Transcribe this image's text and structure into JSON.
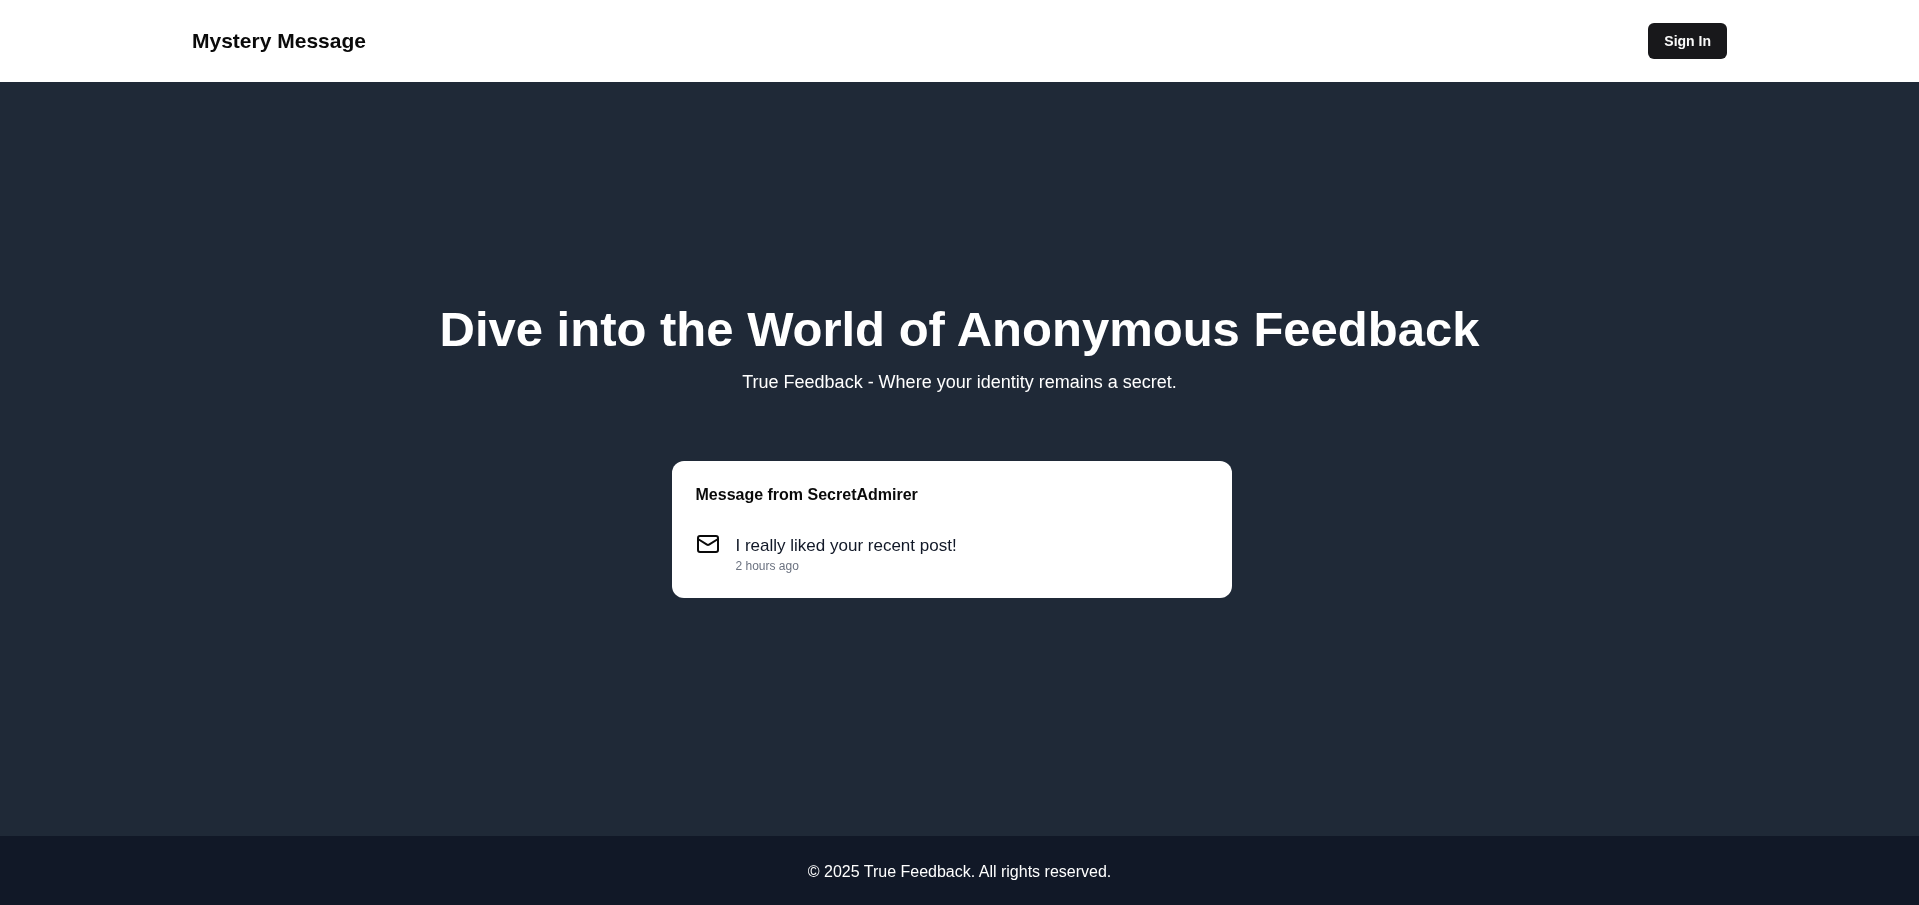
{
  "header": {
    "logo": "Mystery Message",
    "sign_in_button": "Sign In"
  },
  "hero": {
    "title": "Dive into the World of Anonymous Feedback",
    "subtitle": "True Feedback - Where your identity remains a secret."
  },
  "messages": [
    {
      "title": "Message from SecretAdmirer",
      "content": "I really liked your recent post!",
      "received": "2 hours ago"
    }
  ],
  "footer": {
    "copyright": "© 2025 True Feedback. All rights reserved."
  }
}
